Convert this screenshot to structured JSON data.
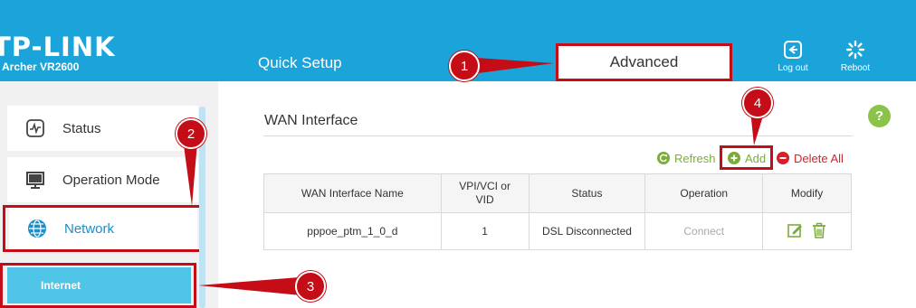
{
  "header": {
    "brand": "TP-LINK",
    "model": "Archer VR2600",
    "quick_setup_label": "Quick Setup",
    "advanced_label": "Advanced",
    "logout_label": "Log out",
    "reboot_label": "Reboot",
    "background_color": "#1ba4d9"
  },
  "sidebar": {
    "items": [
      {
        "label": "Status",
        "icon": "status-icon"
      },
      {
        "label": "Operation Mode",
        "icon": "monitor-icon"
      },
      {
        "label": "Network",
        "icon": "globe-icon",
        "active": true
      }
    ],
    "submenu": [
      {
        "label": "Internet",
        "active": true
      }
    ]
  },
  "main": {
    "section_title": "WAN Interface",
    "help_label": "?",
    "toolbar": {
      "refresh_label": "Refresh",
      "add_label": "Add",
      "delete_all_label": "Delete All"
    },
    "table": {
      "headers": {
        "name": "WAN Interface Name",
        "vpi_line1": "VPI/VCI or",
        "vpi_line2": "VID",
        "status": "Status",
        "operation": "Operation",
        "modify": "Modify"
      },
      "rows": [
        {
          "name": "pppoe_ptm_1_0_d",
          "vpi": "1",
          "status": "DSL Disconnected",
          "operation": "Connect",
          "modify_icons": [
            "edit-icon",
            "trash-icon"
          ]
        }
      ]
    }
  },
  "callouts": [
    "1",
    "2",
    "3",
    "4"
  ],
  "colors": {
    "accent": "#1ba4d9",
    "highlight": "#c40d16",
    "green": "#7aad38",
    "red": "#d2232a",
    "submenu_active": "#4fc4e6"
  }
}
